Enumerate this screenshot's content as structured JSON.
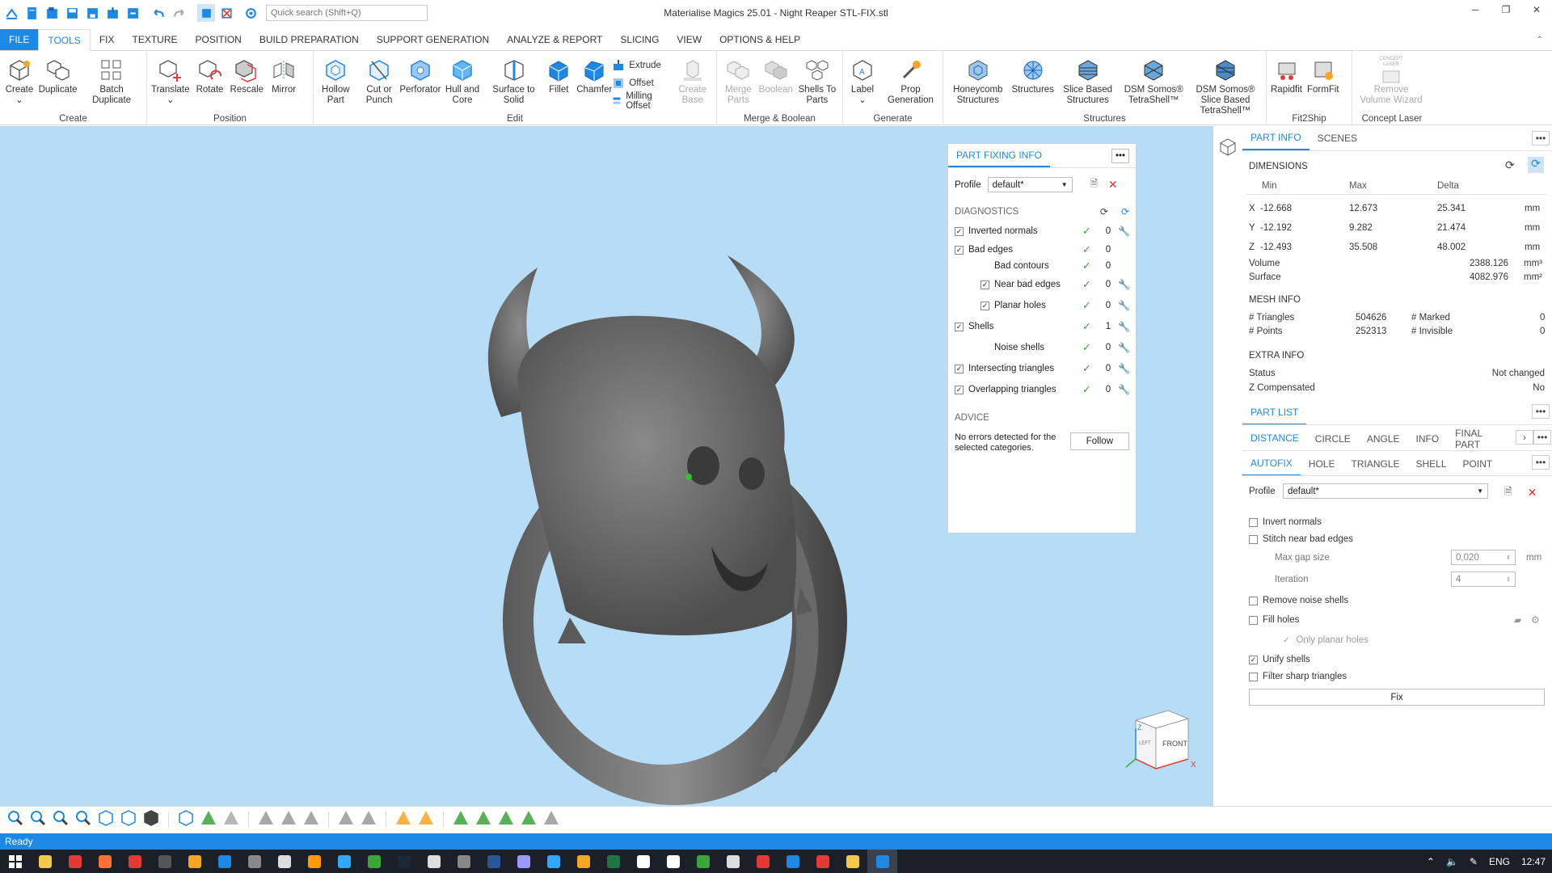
{
  "titlebar": {
    "search_placeholder": "Quick search (Shift+Q)",
    "title": "Materialise Magics 25.01 - Night Reaper STL-FIX.stl",
    "minimize": "─",
    "restore": "❐",
    "close": "✕"
  },
  "menu": {
    "items": [
      "FILE",
      "TOOLS",
      "FIX",
      "TEXTURE",
      "POSITION",
      "BUILD PREPARATION",
      "SUPPORT GENERATION",
      "ANALYZE & REPORT",
      "SLICING",
      "VIEW",
      "OPTIONS & HELP"
    ],
    "active": "TOOLS"
  },
  "ribbon": {
    "create": {
      "label": "Create",
      "buttons": [
        "Create",
        "Duplicate",
        "Batch Duplicate"
      ]
    },
    "position": {
      "label": "Position",
      "buttons": [
        "Translate",
        "Rotate",
        "Rescale",
        "Mirror"
      ]
    },
    "edit": {
      "label": "Edit",
      "buttons": [
        "Hollow Part",
        "Cut or Punch",
        "Perforator",
        "Hull and Core",
        "Surface to Solid",
        "Fillet",
        "Chamfer"
      ],
      "small": [
        "Extrude",
        "Offset",
        "Milling Offset"
      ],
      "create_base": "Create Base"
    },
    "merge": {
      "label": "Merge & Boolean",
      "buttons": [
        "Merge Parts",
        "Boolean",
        "Shells To Parts"
      ]
    },
    "generate": {
      "label": "Generate",
      "buttons": [
        "Label",
        "Prop Generation"
      ]
    },
    "structures": {
      "label": "Structures",
      "buttons": [
        "Honeycomb Structures",
        "Structures",
        "Slice Based Structures",
        "DSM Somos® TetraShell™",
        "DSM Somos® Slice Based TetraShell™"
      ]
    },
    "fit2ship": {
      "label": "Fit2Ship",
      "buttons": [
        "Rapidfit",
        "FormFit"
      ]
    },
    "concept": {
      "label": "Concept Laser",
      "buttons": [
        "Remove Volume Wizard"
      ],
      "logo": "CONCEPT LASER"
    }
  },
  "part_fixing": {
    "tab": "PART FIXING INFO",
    "profile_label": "Profile",
    "profile_value": "default*",
    "diagnostics_label": "DIAGNOSTICS",
    "rows": [
      {
        "label": "Inverted normals",
        "checked": true,
        "value": "0",
        "wrench": true,
        "indent": 0
      },
      {
        "label": "Bad edges",
        "checked": true,
        "value": "0",
        "wrench": false,
        "indent": 0
      },
      {
        "label": "Bad contours",
        "checked": null,
        "value": "0",
        "wrench": false,
        "indent": 1
      },
      {
        "label": "Near bad edges",
        "checked": true,
        "value": "0",
        "wrench": true,
        "indent": 1
      },
      {
        "label": "Planar holes",
        "checked": true,
        "value": "0",
        "wrench": true,
        "indent": 1
      },
      {
        "label": "Shells",
        "checked": true,
        "value": "1",
        "wrench": true,
        "indent": 0
      },
      {
        "label": "Noise shells",
        "checked": null,
        "value": "0",
        "wrench": true,
        "indent": 1
      },
      {
        "label": "Intersecting triangles",
        "checked": true,
        "value": "0",
        "wrench": true,
        "indent": 0
      },
      {
        "label": "Overlapping triangles",
        "checked": true,
        "value": "0",
        "wrench": true,
        "indent": 0
      }
    ],
    "advice_label": "ADVICE",
    "advice_text": "No errors detected for the selected categories.",
    "follow": "Follow"
  },
  "right": {
    "tabs": [
      "PART INFO",
      "SCENES"
    ],
    "dimensions_label": "DIMENSIONS",
    "dim_headers": [
      "Min",
      "Max",
      "Delta"
    ],
    "dims": [
      {
        "axis": "X",
        "min": "-12.668",
        "max": "12.673",
        "delta": "25.341",
        "unit": "mm"
      },
      {
        "axis": "Y",
        "min": "-12.192",
        "max": "9.282",
        "delta": "21.474",
        "unit": "mm"
      },
      {
        "axis": "Z",
        "min": "-12.493",
        "max": "35.508",
        "delta": "48.002",
        "unit": "mm"
      }
    ],
    "volume_label": "Volume",
    "volume": "2388.126",
    "volume_unit": "mm³",
    "surface_label": "Surface",
    "surface": "4082.976",
    "surface_unit": "mm²",
    "mesh_label": "MESH INFO",
    "triangles_label": "# Triangles",
    "triangles": "504626",
    "points_label": "# Points",
    "points": "252313",
    "marked_label": "# Marked",
    "marked": "0",
    "invisible_label": "# Invisible",
    "invisible": "0",
    "extra_label": "EXTRA INFO",
    "status_label": "Status",
    "status": "Not changed",
    "zc_label": "Z Compensated",
    "zc": "No",
    "partlist": "PART LIST",
    "measure_tabs": [
      "DISTANCE",
      "CIRCLE",
      "ANGLE",
      "INFO",
      "FINAL PART"
    ],
    "fix_tabs": [
      "AUTOFIX",
      "HOLE",
      "TRIANGLE",
      "SHELL",
      "POINT"
    ],
    "profile_label": "Profile",
    "profile_value": "default*",
    "options": [
      {
        "label": "Invert normals",
        "checked": false
      },
      {
        "label": "Stitch near bad edges",
        "checked": false
      }
    ],
    "max_gap_label": "Max gap size",
    "max_gap": "0,020",
    "max_gap_unit": "mm",
    "iteration_label": "Iteration",
    "iteration": "4",
    "remove_noise": "Remove noise shells",
    "fill_holes": "Fill holes",
    "only_planar": "Only planar holes",
    "unify": "Unify shells",
    "filter": "Filter sharp triangles",
    "fix_button": "Fix"
  },
  "viewcube": {
    "front": "FRONT",
    "left": "LEFT",
    "z": "Z",
    "x": "X"
  },
  "status": "Ready",
  "tray": {
    "lang": "ENG",
    "time": "12:47"
  },
  "colors": {
    "accent": "#1e88e5",
    "viewport": "#b6ddf5",
    "check": "#3aa53a"
  }
}
